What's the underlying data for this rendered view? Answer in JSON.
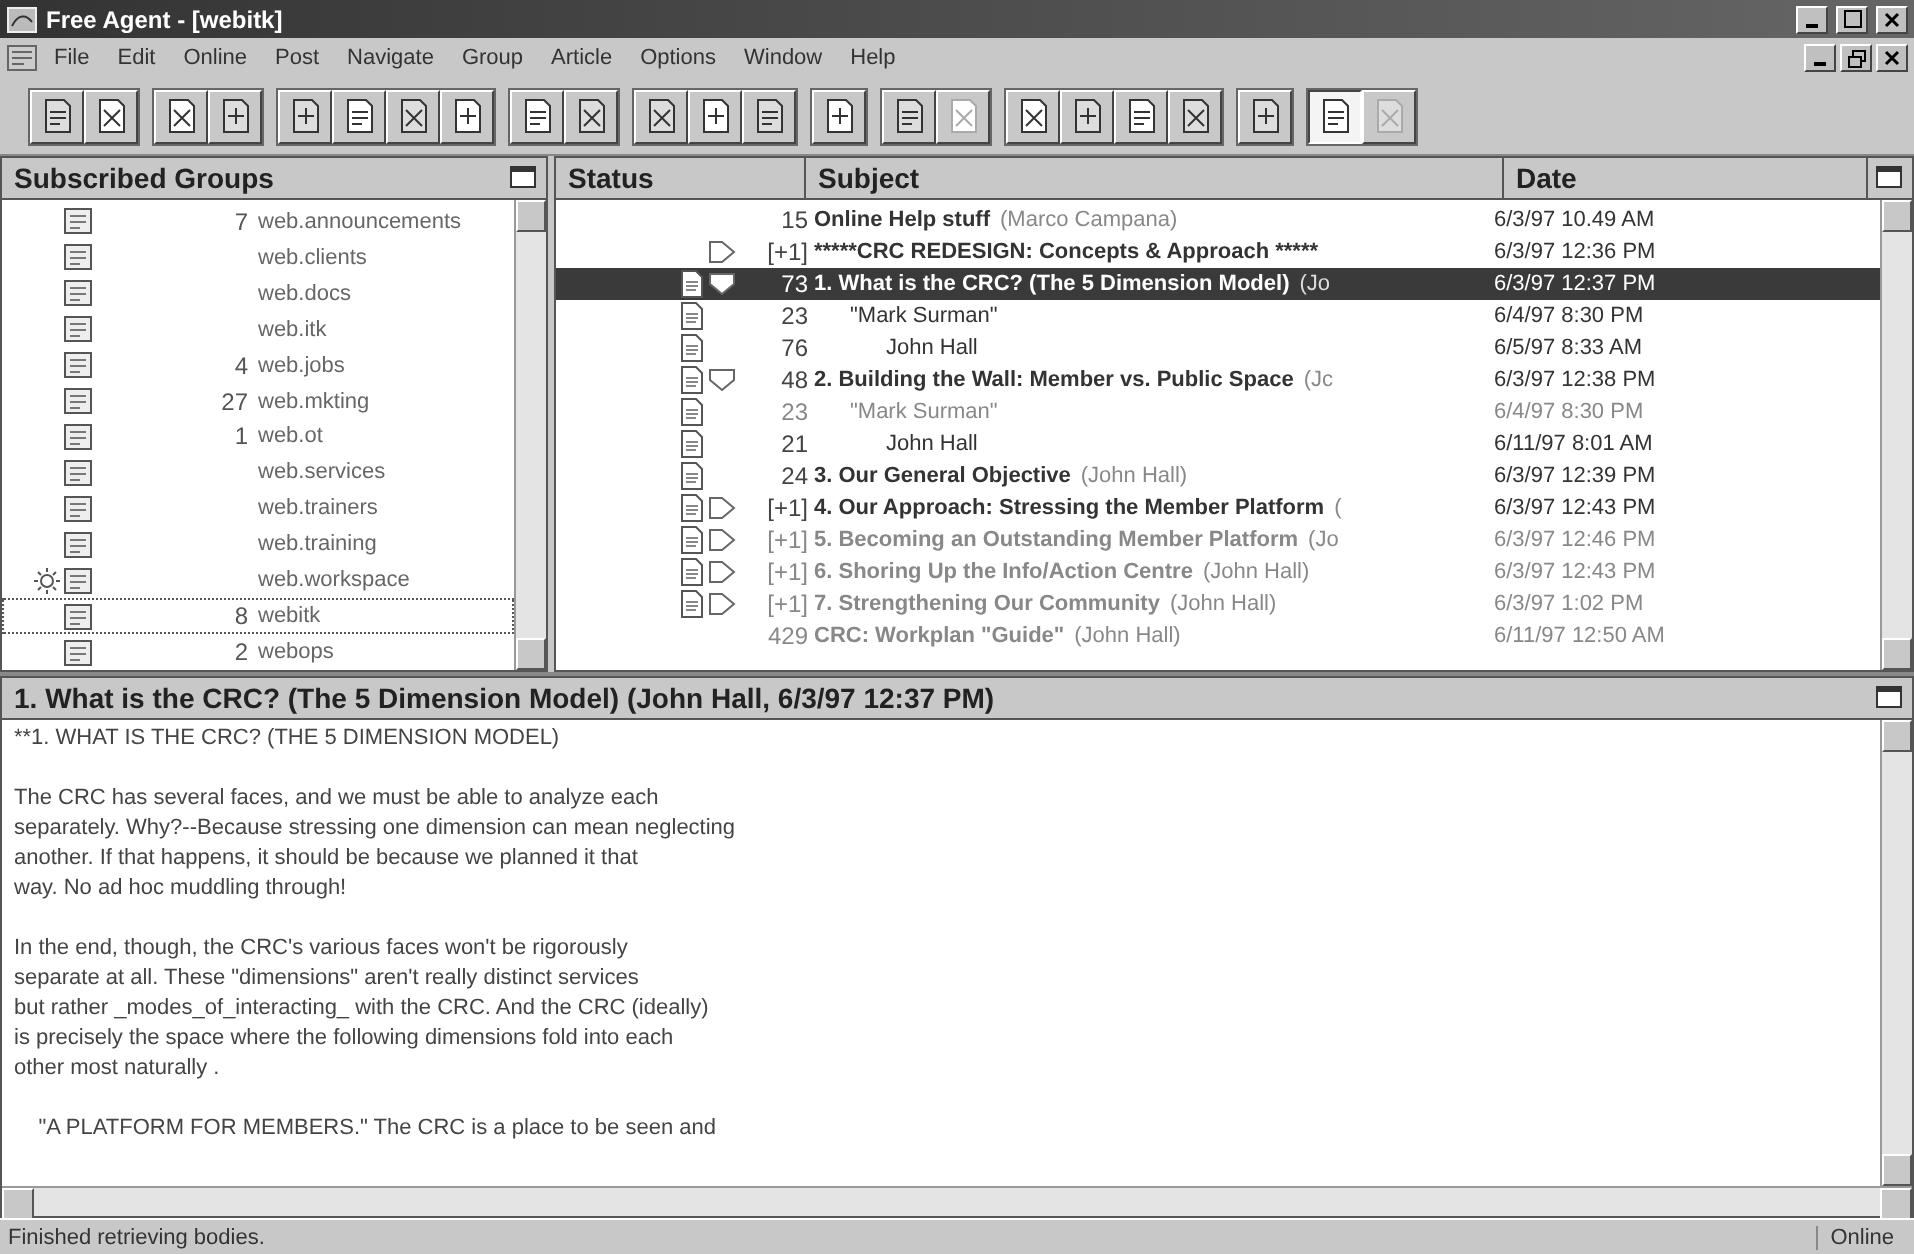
{
  "window": {
    "title": "Free Agent - [webitk]"
  },
  "menu": [
    "File",
    "Edit",
    "Online",
    "Post",
    "Navigate",
    "Group",
    "Article",
    "Options",
    "Window",
    "Help"
  ],
  "toolbar": [
    [
      {
        "disabled": false,
        "pressed": false
      },
      {
        "disabled": false,
        "pressed": false
      }
    ],
    [
      {
        "disabled": false,
        "pressed": false
      },
      {
        "disabled": false,
        "pressed": false
      }
    ],
    [
      {
        "disabled": false,
        "pressed": false
      },
      {
        "disabled": false,
        "pressed": false
      },
      {
        "disabled": false,
        "pressed": false
      },
      {
        "disabled": false,
        "pressed": false
      }
    ],
    [
      {
        "disabled": false,
        "pressed": false
      },
      {
        "disabled": false,
        "pressed": false
      }
    ],
    [
      {
        "disabled": false,
        "pressed": false
      },
      {
        "disabled": false,
        "pressed": false
      },
      {
        "disabled": false,
        "pressed": false
      }
    ],
    [
      {
        "disabled": false,
        "pressed": false
      }
    ],
    [
      {
        "disabled": false,
        "pressed": false
      },
      {
        "disabled": true,
        "pressed": false
      }
    ],
    [
      {
        "disabled": false,
        "pressed": false
      },
      {
        "disabled": false,
        "pressed": false
      },
      {
        "disabled": false,
        "pressed": false
      },
      {
        "disabled": false,
        "pressed": false
      }
    ],
    [
      {
        "disabled": false,
        "pressed": false
      }
    ],
    [
      {
        "disabled": false,
        "pressed": true
      },
      {
        "disabled": true,
        "pressed": false
      }
    ]
  ],
  "groups_pane": {
    "title": "Subscribed Groups",
    "items": [
      {
        "count": "7",
        "name": "web.announcements",
        "selected": false,
        "busy": false
      },
      {
        "name": "web.clients",
        "selected": false,
        "busy": false
      },
      {
        "name": "web.docs",
        "selected": false,
        "busy": false
      },
      {
        "name": "web.itk",
        "selected": false,
        "busy": false
      },
      {
        "count": "4",
        "name": "web.jobs",
        "selected": false,
        "busy": false
      },
      {
        "count": "27",
        "name": "web.mkting",
        "selected": false,
        "busy": false
      },
      {
        "count": "1",
        "name": "web.ot",
        "selected": false,
        "busy": false
      },
      {
        "name": "web.services",
        "selected": false,
        "busy": false
      },
      {
        "name": "web.trainers",
        "selected": false,
        "busy": false
      },
      {
        "name": "web.training",
        "selected": false,
        "busy": false
      },
      {
        "name": "web.workspace",
        "selected": false,
        "busy": true
      },
      {
        "count": "8",
        "name": "webitk",
        "selected": true,
        "busy": false
      },
      {
        "count": "2",
        "name": "webops",
        "selected": false,
        "busy": false
      }
    ]
  },
  "messages": {
    "columns": [
      "Status",
      "Subject",
      "Date"
    ],
    "rows": [
      {
        "count": "15",
        "subject": "Online Help stuff",
        "author": "(Marco Campana)",
        "date": "6/3/97 10.49 AM",
        "bold": true,
        "read": false,
        "doc": false,
        "selected": false
      },
      {
        "count": "[+1]",
        "subject": "*****CRC REDESIGN: Concepts & Approach *****",
        "date": "6/3/97 12:36 PM",
        "bold": true,
        "read": false,
        "doc": false,
        "expanded": false,
        "selected": false
      },
      {
        "count": "73",
        "subject": "1. What is the CRC? (The 5 Dimension Model)",
        "author": "(Jo",
        "date": "6/3/97 12:37 PM",
        "bold": true,
        "read": false,
        "doc": true,
        "expanded": true,
        "selected": true,
        "children": [
          {
            "count": "23",
            "subject": "\"Mark Surman\"",
            "date": "6/4/97 8:30 PM",
            "bold": false,
            "read": false,
            "doc": true,
            "selected": false,
            "children": [
              {
                "count": "76",
                "subject": "John Hall",
                "date": "6/5/97 8:33 AM",
                "bold": false,
                "read": false,
                "doc": true,
                "selected": false
              }
            ]
          }
        ]
      },
      {
        "count": "48",
        "subject": "2. Building the Wall: Member vs. Public Space",
        "author": "(Jc",
        "date": "6/3/97 12:38 PM",
        "bold": true,
        "read": false,
        "doc": true,
        "expanded": true,
        "selected": false,
        "children": [
          {
            "count": "23",
            "subject": "\"Mark Surman\"",
            "date": "6/4/97 8:30 PM",
            "bold": false,
            "read": true,
            "doc": true,
            "selected": false,
            "children": [
              {
                "count": "21",
                "subject": "John Hall",
                "date": "6/11/97 8:01 AM",
                "bold": false,
                "read": false,
                "doc": true,
                "selected": false
              }
            ]
          }
        ]
      },
      {
        "count": "24",
        "subject": "3. Our General Objective",
        "author": "(John Hall)",
        "date": "6/3/97 12:39 PM",
        "bold": true,
        "read": false,
        "doc": true,
        "selected": false
      },
      {
        "count": "[+1]",
        "subject": "4. Our Approach: Stressing the Member Platform",
        "author": "(",
        "date": "6/3/97 12:43 PM",
        "bold": true,
        "read": false,
        "doc": true,
        "expanded": false,
        "selected": false
      },
      {
        "count": "[+1]",
        "subject": "5. Becoming an Outstanding Member Platform",
        "author": "(Jo",
        "date": "6/3/97 12:46 PM",
        "bold": true,
        "read": true,
        "doc": true,
        "expanded": false,
        "selected": false
      },
      {
        "count": "[+1]",
        "subject": "6. Shoring Up the Info/Action Centre",
        "author": "(John Hall)",
        "date": "6/3/97 12:43 PM",
        "bold": true,
        "read": true,
        "doc": true,
        "expanded": false,
        "selected": false
      },
      {
        "count": "[+1]",
        "subject": "7. Strengthening Our Community",
        "author": "(John Hall)",
        "date": "6/3/97 1:02 PM",
        "bold": true,
        "read": true,
        "doc": true,
        "expanded": false,
        "selected": false
      },
      {
        "count": "429",
        "subject": "CRC: Workplan \"Guide\"",
        "author": "(John Hall)",
        "date": "6/11/97 12:50 AM",
        "bold": true,
        "read": true,
        "doc": false,
        "selected": false
      }
    ]
  },
  "article": {
    "title": "1. What is the CRC? (The 5 Dimension Model) (John Hall, 6/3/97 12:37 PM)",
    "paragraphs": [
      [
        "**1. WHAT IS THE CRC? (THE 5 DIMENSION MODEL)"
      ],
      [
        "The CRC has several faces, and we must be able to analyze each",
        "separately. Why?--Because stressing one dimension can mean neglecting",
        "another. If that happens, it should be because we planned it that",
        "way. No ad hoc muddling through!"
      ],
      [
        "In the end, though, the CRC's various faces won't be rigorously",
        "separate at all. These \"dimensions\" aren't really distinct services",
        "but rather _modes_of_interacting_ with the CRC. And the CRC (ideally)",
        "is precisely the space where the following dimensions fold into each",
        "other most naturally ."
      ],
      [
        "    \"A PLATFORM FOR MEMBERS.\" The CRC is a place to be seen and"
      ]
    ]
  },
  "status_bar": {
    "message": "Finished retrieving bodies.",
    "connection": "Online"
  }
}
